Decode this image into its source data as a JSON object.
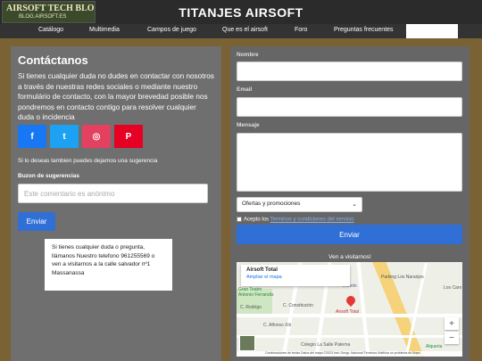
{
  "header": {
    "logo_line1": "AIRSOFT TECH BLOG",
    "logo_line2": "BLOG.AIRSOFT.ES",
    "title": "TITANJES AIRSOFT"
  },
  "nav": {
    "items": [
      "Catálogo",
      "Multimedia",
      "Campos de juego",
      "Que es el airsoft",
      "Foro",
      "Preguntas frecuentes"
    ],
    "active_label": ""
  },
  "contact": {
    "title": "Contáctanos",
    "intro": "Si tienes cualquier duda no dudes en contactar con nosotros a través de nuestras redes sociales o mediante nuestro formulário de contacto, con la mayor brevedad posible nos pondremos en contacto contigo para resolver cualquier duda o incidencia",
    "social": {
      "facebook": "f",
      "twitter": "t",
      "instagram": "◎",
      "pinterest": "P"
    },
    "suggestion_text": "Si lo deseas tambien puedes dejarnos una sugerencia",
    "suggestion_label": "Buzon de sugerencias",
    "suggestion_placeholder": "Este comentario es anónimo",
    "send_label": "Enviar",
    "info_card": "Si tienes cualquier duda o pregunta, llámanos Nuestro telefono 961255569 o ven a visitarnos a la calle salvador nº1 Massanassa"
  },
  "form": {
    "name_label": "Nombre",
    "email_label": "Email",
    "message_label": "Mensaje",
    "select_value": "Ofertas y promociones",
    "terms_prefix": "Acepto los ",
    "terms_link": "Terminos y condiciones del servicio",
    "send_label": "Enviar",
    "visit_text": "Ven a visitarnos!"
  },
  "map": {
    "place_name": "Airsoft Total",
    "place_link": "Ampliar el mapa",
    "pin_label": "Airsoft Total",
    "labels": {
      "a": "Parking Los Naranjos",
      "b": "Velarde",
      "c": "Gran Teatro",
      "d": "Antonio Ferrandis",
      "e": "Colegio La Salle Paterna",
      "f": "Alqueria",
      "g": "Los Caro",
      "h": "C. Rodrigo",
      "i": "C. Constitución",
      "j": "C. Alfonso Xiii"
    },
    "zoom_in": "+",
    "zoom_out": "−",
    "attribution": "Combinaciones de teclas   Datos del mapa ©2023 Inst. Geogr. Nacional   Términos   Notificar un problema de Maps"
  }
}
